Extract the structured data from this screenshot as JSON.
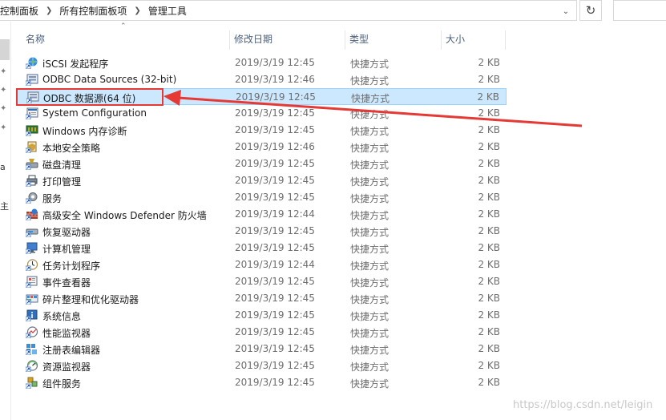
{
  "address_bar": {
    "breadcrumbs": [
      "控制面板",
      "所有控制面板项",
      "管理工具"
    ],
    "separator": ">"
  },
  "columns": {
    "name": "名称",
    "date": "修改日期",
    "type": "类型",
    "size": "大小"
  },
  "nav_pane": {
    "fragments": [
      "a",
      "主"
    ]
  },
  "files": [
    {
      "name": "iSCSI 发起程序",
      "date": "2019/3/19 12:45",
      "type": "快捷方式",
      "size": "2 KB",
      "icon": "iscsi-globe-icon"
    },
    {
      "name": "ODBC Data Sources (32-bit)",
      "date": "2019/3/19 12:46",
      "type": "快捷方式",
      "size": "2 KB",
      "icon": "odbc-icon"
    },
    {
      "name": "ODBC 数据源(64 位)",
      "date": "2019/3/19 12:45",
      "type": "快捷方式",
      "size": "2 KB",
      "icon": "odbc-icon"
    },
    {
      "name": "System Configuration",
      "date": "2019/3/19 12:45",
      "type": "快捷方式",
      "size": "2 KB",
      "icon": "system-config-icon"
    },
    {
      "name": "Windows 内存诊断",
      "date": "2019/3/19 12:45",
      "type": "快捷方式",
      "size": "2 KB",
      "icon": "memory-diagnostic-icon"
    },
    {
      "name": "本地安全策略",
      "date": "2019/3/19 12:46",
      "type": "快捷方式",
      "size": "2 KB",
      "icon": "security-policy-icon"
    },
    {
      "name": "磁盘清理",
      "date": "2019/3/19 12:45",
      "type": "快捷方式",
      "size": "2 KB",
      "icon": "disk-cleanup-icon"
    },
    {
      "name": "打印管理",
      "date": "2019/3/19 12:45",
      "type": "快捷方式",
      "size": "2 KB",
      "icon": "print-management-icon"
    },
    {
      "name": "服务",
      "date": "2019/3/19 12:45",
      "type": "快捷方式",
      "size": "2 KB",
      "icon": "services-gear-icon"
    },
    {
      "name": "高级安全 Windows Defender 防火墙",
      "date": "2019/3/19 12:44",
      "type": "快捷方式",
      "size": "2 KB",
      "icon": "firewall-icon"
    },
    {
      "name": "恢复驱动器",
      "date": "2019/3/19 12:45",
      "type": "快捷方式",
      "size": "2 KB",
      "icon": "recovery-drive-icon"
    },
    {
      "name": "计算机管理",
      "date": "2019/3/19 12:45",
      "type": "快捷方式",
      "size": "2 KB",
      "icon": "computer-management-icon"
    },
    {
      "name": "任务计划程序",
      "date": "2019/3/19 12:44",
      "type": "快捷方式",
      "size": "2 KB",
      "icon": "task-scheduler-icon"
    },
    {
      "name": "事件查看器",
      "date": "2019/3/19 12:45",
      "type": "快捷方式",
      "size": "2 KB",
      "icon": "event-viewer-icon"
    },
    {
      "name": "碎片整理和优化驱动器",
      "date": "2019/3/19 12:45",
      "type": "快捷方式",
      "size": "2 KB",
      "icon": "defrag-icon"
    },
    {
      "name": "系统信息",
      "date": "2019/3/19 12:45",
      "type": "快捷方式",
      "size": "2 KB",
      "icon": "system-info-icon"
    },
    {
      "name": "性能监视器",
      "date": "2019/3/19 12:45",
      "type": "快捷方式",
      "size": "2 KB",
      "icon": "performance-monitor-icon"
    },
    {
      "name": "注册表编辑器",
      "date": "2019/3/19 12:45",
      "type": "快捷方式",
      "size": "2 KB",
      "icon": "registry-editor-icon"
    },
    {
      "name": "资源监视器",
      "date": "2019/3/19 12:45",
      "type": "快捷方式",
      "size": "2 KB",
      "icon": "resource-monitor-icon"
    },
    {
      "name": "组件服务",
      "date": "2019/3/19 12:45",
      "type": "快捷方式",
      "size": "2 KB",
      "icon": "component-services-icon"
    }
  ],
  "selected_index": 2,
  "watermark": "https://blog.csdn.net/leigin",
  "colors": {
    "selection_bg": "#cce8ff",
    "selection_border": "#99d1ff",
    "annotation_red": "#e53935",
    "header_text": "#4c607a"
  }
}
